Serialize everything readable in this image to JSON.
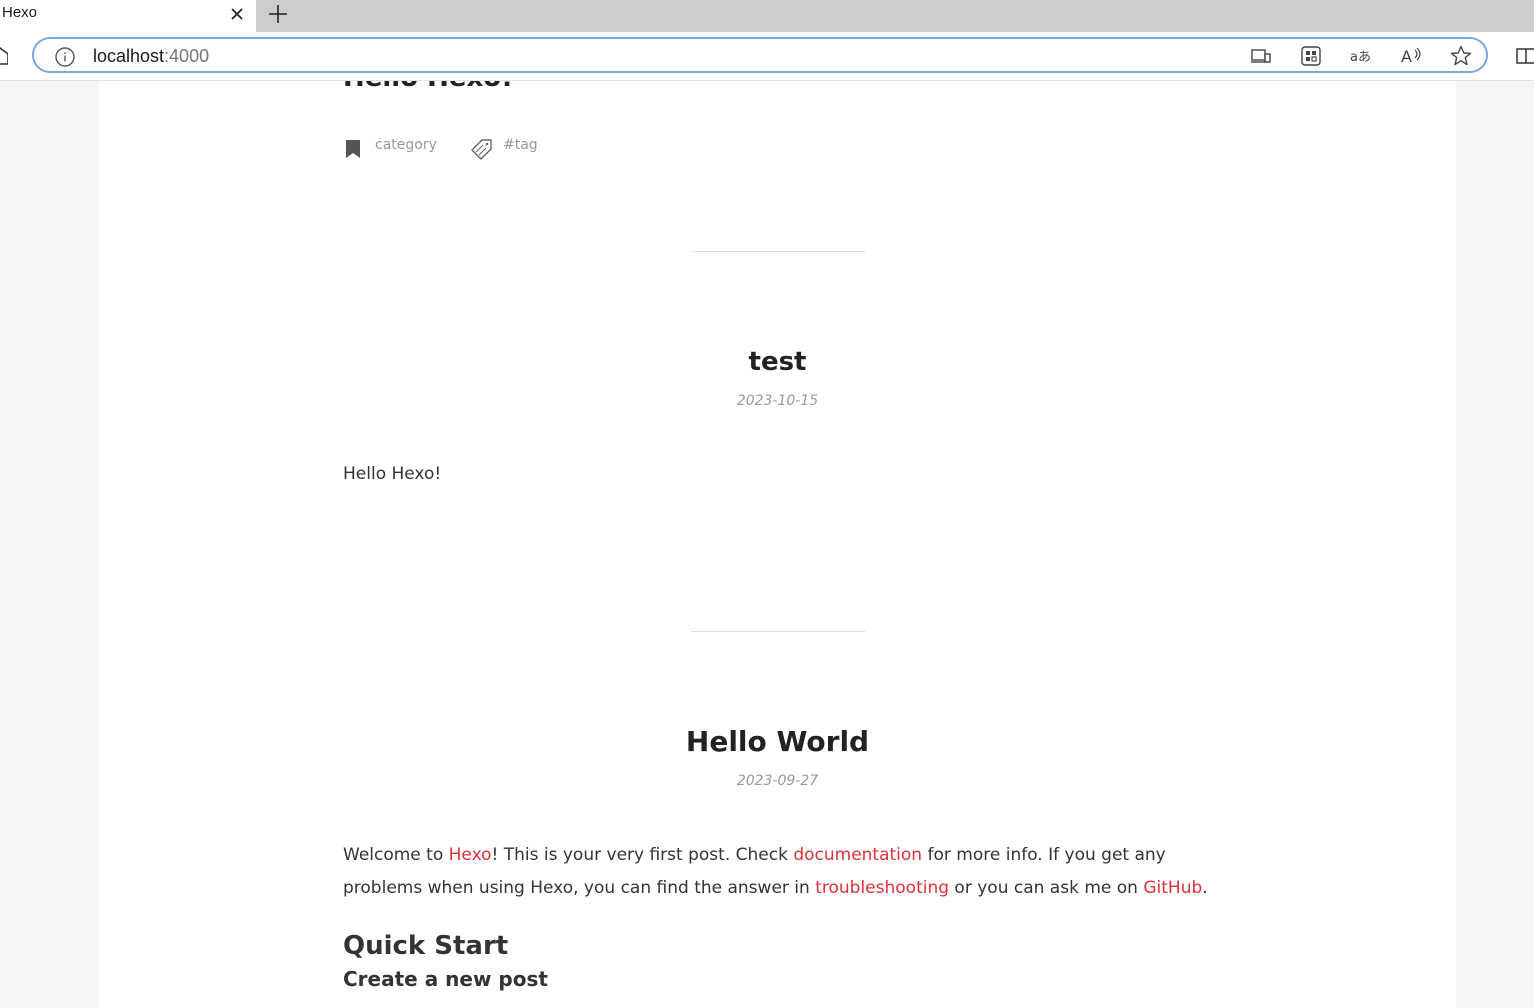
{
  "browser": {
    "tab_title": "Hexo",
    "url_host": "localhost",
    "url_port": ":4000"
  },
  "page": {
    "previous_post": {
      "title_cut": "Hello Hexo!",
      "category": "category",
      "tag": "#tag"
    },
    "posts": [
      {
        "title": "test",
        "date": "2023-10-15",
        "body": "Hello Hexo!"
      },
      {
        "title": "Hello World",
        "date": "2023-09-27",
        "para": {
          "p1": "Welcome to ",
          "link1": "Hexo",
          "p2": "! This is your very first post. Check ",
          "link2": "documentation",
          "p3": " for more info. If you get any problems when using Hexo, you can find the answer in ",
          "link3": "troubleshooting",
          "p4": " or you can ask me on ",
          "link4": "GitHub",
          "p5": "."
        },
        "h2": "Quick Start",
        "h3": "Create a new post"
      }
    ]
  },
  "colors": {
    "link": "#e0303a",
    "address_focus": "#7aa7e0"
  }
}
